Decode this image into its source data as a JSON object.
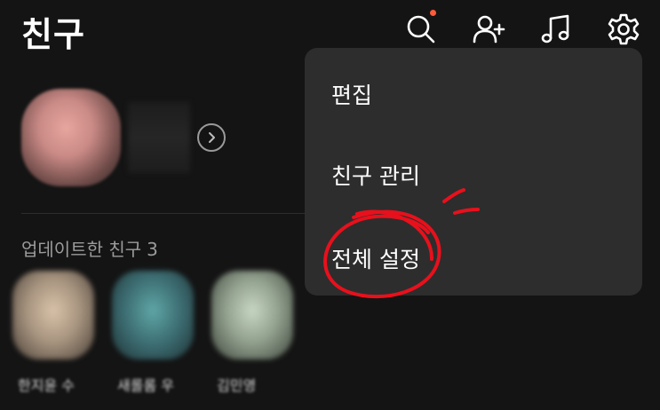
{
  "header": {
    "title": "친구",
    "icons": [
      "search-icon",
      "add-friend-icon",
      "music-icon",
      "settings-icon"
    ],
    "notification_color": "#ff5b3a"
  },
  "updated": {
    "label": "업데이트한 친구",
    "count": "3"
  },
  "friends": [
    {
      "name": "한지윤 수",
      "avatar_colors": [
        "#d8c2a8",
        "#8a7a66"
      ]
    },
    {
      "name": "새롤롬 우",
      "avatar_colors": [
        "#5fa6a6",
        "#2b4d52"
      ]
    },
    {
      "name": "김민영",
      "avatar_colors": [
        "#c7d6c2",
        "#6b7a68"
      ]
    }
  ],
  "menu": {
    "items": [
      "편집",
      "친구 관리",
      "전체 설정"
    ]
  },
  "colors": {
    "background": "#141414",
    "menu_background": "#2d2d2d",
    "annotation_red": "#e8101c"
  }
}
